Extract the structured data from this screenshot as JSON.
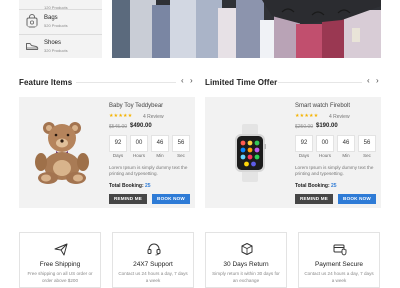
{
  "categories": [
    {
      "name": "",
      "count": "120 Products",
      "icon": "shirt-icon"
    },
    {
      "name": "Bags",
      "count": "520 Products",
      "icon": "bag-icon"
    },
    {
      "name": "Shoes",
      "count": "320 Products",
      "icon": "shoe-icon"
    }
  ],
  "featured": {
    "title": "Feature Items",
    "prev": "‹",
    "next": "›",
    "product": {
      "name": "Baby Toy Teddybear",
      "stars": "★★★★★",
      "review": "4 Review",
      "old_price": "$545.00",
      "new_price": "$490.00",
      "timer": [
        {
          "value": "92",
          "label": "Days"
        },
        {
          "value": "00",
          "label": "Hours"
        },
        {
          "value": "46",
          "label": "Min"
        },
        {
          "value": "56",
          "label": "Sec"
        }
      ],
      "description": "Lorem Ipsum is simply dummy text the printing and typesetting.",
      "booking_label": "Total Booking:",
      "booking_count": "25",
      "remind_label": "REMIND ME",
      "book_label": "BOOK NOW"
    }
  },
  "limited": {
    "title": "Limited Time Offer",
    "prev": "‹",
    "next": "›",
    "product": {
      "name": "Smart watch Firebolt",
      "stars": "★★★★★",
      "review": "4 Review",
      "old_price": "$250.00",
      "new_price": "$190.00",
      "timer": [
        {
          "value": "92",
          "label": "Days"
        },
        {
          "value": "00",
          "label": "Hours"
        },
        {
          "value": "46",
          "label": "Min"
        },
        {
          "value": "56",
          "label": "Sec"
        }
      ],
      "description": "Lorem Ipsum is simply dummy text the printing and typesetting.",
      "booking_label": "Total Booking:",
      "booking_count": "25",
      "remind_label": "REMIND ME",
      "book_label": "BOOK NOW"
    }
  },
  "services": [
    {
      "title": "Free Shipping",
      "desc": "Free shipping on all US order or order above $200",
      "icon": "airplane-icon"
    },
    {
      "title": "24X7 Support",
      "desc": "Contact us 24 hours a day, 7 days a week",
      "icon": "headset-icon"
    },
    {
      "title": "30 Days Return",
      "desc": "Simply return it within 30 days for an exchange",
      "icon": "box-return-icon"
    },
    {
      "title": "Payment Secure",
      "desc": "Contact us 24 hours a day, 7 days a week",
      "icon": "shield-payment-icon"
    }
  ],
  "colors": {
    "accent": "#2e7bd6",
    "button_dark": "#464646",
    "star": "#f5b301",
    "card_bg": "#f2f2f2"
  }
}
